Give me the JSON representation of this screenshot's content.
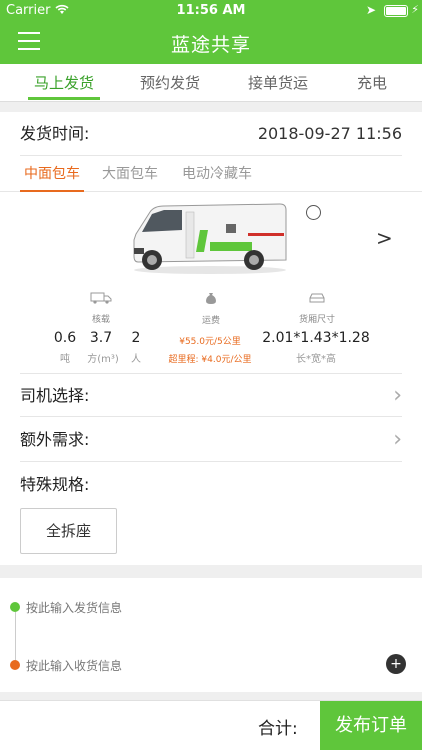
{
  "status": {
    "carrier": "Carrier",
    "time": "11:56 AM"
  },
  "header": {
    "title": "蓝途共享"
  },
  "tabs": [
    {
      "label": "马上发货"
    },
    {
      "label": "预约发货"
    },
    {
      "label": "接单货运"
    },
    {
      "label": "充电"
    }
  ],
  "ship_time": {
    "label": "发货时间:",
    "value": "2018-09-27 11:56"
  },
  "vehicle_tabs": [
    {
      "label": "中面包车"
    },
    {
      "label": "大面包车"
    },
    {
      "label": "电动冷藏车"
    }
  ],
  "specs": {
    "load": {
      "label": "核载",
      "weight": "0.6",
      "weight_unit": "吨",
      "volume": "3.7",
      "volume_unit": "方(m³)",
      "people": "2",
      "people_unit": "人"
    },
    "fare": {
      "label": "运费",
      "base": "¥55.0元/5公里",
      "extra": "超里程: ¥4.0元/公里"
    },
    "size": {
      "label": "货厢尺寸",
      "value": "2.01*1.43*1.28",
      "unit": "长*宽*高"
    }
  },
  "driver": {
    "label": "司机选择:"
  },
  "extra": {
    "label": "额外需求:"
  },
  "special": {
    "label": "特殊规格:",
    "option": "全拆座"
  },
  "address": {
    "send_placeholder": "按此输入发货信息",
    "recv_placeholder": "按此输入收货信息"
  },
  "footer": {
    "total_label": "合计:",
    "publish_label": "发布订单"
  },
  "colors": {
    "primary": "#5fc63b",
    "accent": "#e86a1e"
  }
}
